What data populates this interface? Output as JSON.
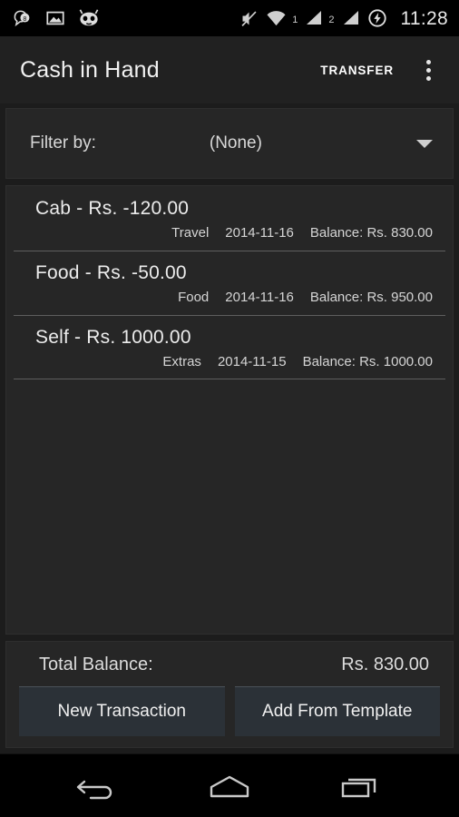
{
  "status_bar": {
    "notifications": [
      {
        "icon": "message-badge-icon",
        "badge": "8"
      },
      {
        "icon": "photo-icon"
      },
      {
        "icon": "cyanogenmod-icon"
      }
    ],
    "mute_icon": "mute-icon",
    "wifi_icon": "wifi-icon",
    "sim1_label": "1",
    "sim2_label": "2",
    "battery_icon": "battery-charging-icon",
    "time": "11:28"
  },
  "app_bar": {
    "title": "Cash in Hand",
    "transfer_label": "TRANSFER",
    "overflow_icon": "overflow-menu-icon"
  },
  "filter": {
    "label": "Filter by:",
    "value": "(None)",
    "caret_icon": "chevron-down-icon"
  },
  "transactions": [
    {
      "title": "Cab  -  Rs. -120.00",
      "category": "Travel",
      "date": "2014-11-16",
      "balance": "Balance: Rs. 830.00"
    },
    {
      "title": "Food  -  Rs. -50.00",
      "category": "Food",
      "date": "2014-11-16",
      "balance": "Balance: Rs. 950.00"
    },
    {
      "title": "Self  -  Rs. 1000.00",
      "category": "Extras",
      "date": "2014-11-15",
      "balance": "Balance: Rs. 1000.00"
    }
  ],
  "footer": {
    "total_label": "Total Balance:",
    "total_value": "Rs. 830.00",
    "new_transaction_label": "New Transaction",
    "add_from_template_label": "Add From Template"
  },
  "nav_bar": {
    "back_icon": "back-icon",
    "home_icon": "home-icon",
    "recents_icon": "recents-icon"
  },
  "colors": {
    "app_bar_bg": "#212121",
    "panel_bg": "#262626",
    "content_bg": "#1c1c1c",
    "button_bg": "#2b3137",
    "text_primary": "#ececec"
  }
}
